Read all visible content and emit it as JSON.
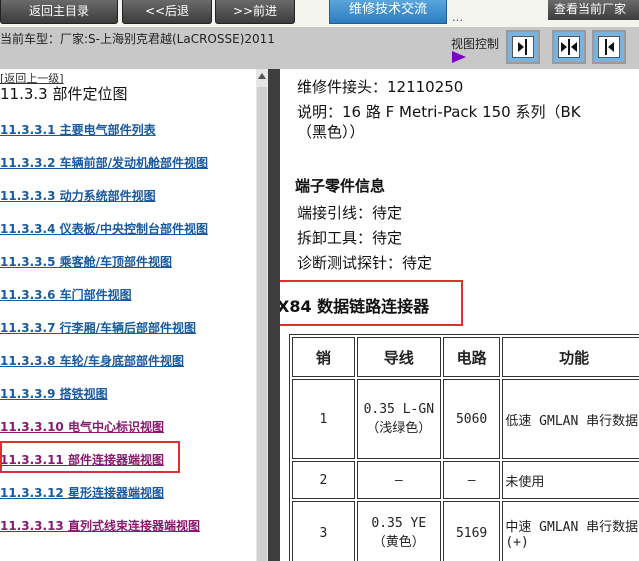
{
  "topbar": {
    "home_label": "返回主目录",
    "back_label": "<<后退",
    "forward_label": ">>前进",
    "exchange_label": "维修技术交流",
    "exchange_more": "…",
    "right_label": "查看当前厂家"
  },
  "model_bar": {
    "text": "当前车型：厂家:S-上海别克君越(LaCROSSE)2011",
    "view_control_label": "视图控制"
  },
  "sidebar": {
    "back_link": "[返回上一级]",
    "title": "11.3.3 部件定位图",
    "items": [
      {
        "label": "11.3.3.1 主要电气部件列表"
      },
      {
        "label": "11.3.3.2 车辆前部/发动机舱部件视图"
      },
      {
        "label": "11.3.3.3 动力系统部件视图"
      },
      {
        "label": "11.3.3.4 仪表板/中央控制台部件视图"
      },
      {
        "label": "11.3.3.5 乘客舱/车顶部件视图"
      },
      {
        "label": "11.3.3.6 车门部件视图"
      },
      {
        "label": "11.3.3.7 行李厢/车辆后部部件视图"
      },
      {
        "label": "11.3.3.8 车轮/车身底部部件视图"
      },
      {
        "label": "11.3.3.9 搭铁视图"
      },
      {
        "label": "11.3.3.10 电气中心标识视图"
      },
      {
        "label": "11.3.3.11 部件连接器端视图"
      },
      {
        "label": "11.3.3.12 星形连接器端视图"
      },
      {
        "label": "11.3.3.13 直列式线束连接器端视图"
      }
    ]
  },
  "content": {
    "part_connector": "维修件接头：12110250",
    "description_line1": "说明：16 路 F Metri-Pack 150 系列（BK",
    "description_line2": "（黑色））",
    "terminal_heading": "端子零件信息",
    "terminal_lead": "端接引线：待定",
    "release_tool": "拆卸工具：待定",
    "probe": "诊断测试探针：待定",
    "connector_title": "X84 数据链路连接器",
    "table": {
      "headers": [
        "销",
        "导线",
        "电路",
        "功能"
      ],
      "rows": [
        {
          "pin": "1",
          "wire": "0.35 L-GN（浅绿色）",
          "circuit": "5060",
          "function": "低速 GMLAN 串行数据"
        },
        {
          "pin": "2",
          "wire": "—",
          "circuit": "—",
          "function": "未使用"
        },
        {
          "pin": "3",
          "wire": "0.35 YE（黄色）",
          "circuit": "5169",
          "function": "中速 GMLAN 串行数据 (+)"
        }
      ]
    }
  }
}
